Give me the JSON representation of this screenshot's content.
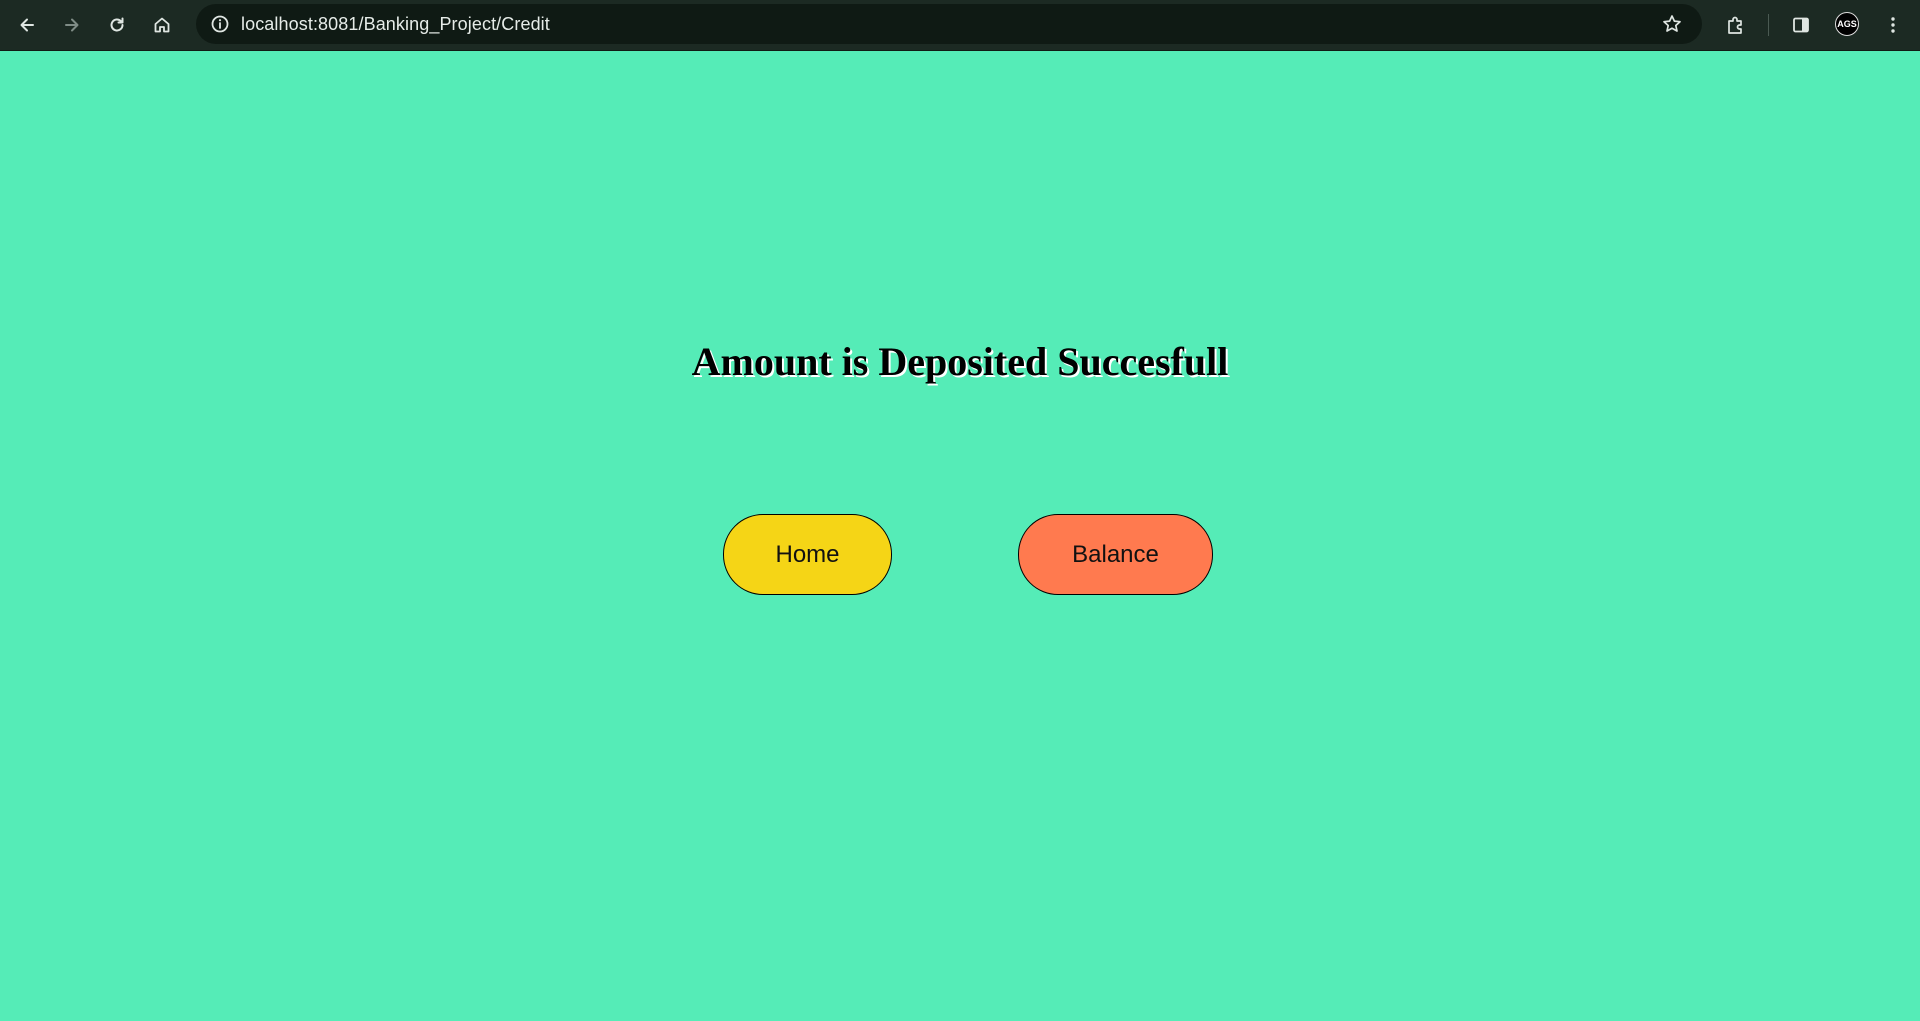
{
  "browser": {
    "url": "localhost:8081/Banking_Project/Credit",
    "profile_initials": "AGS",
    "icons": {
      "back": "back-arrow-icon",
      "forward": "forward-arrow-icon",
      "reload": "reload-icon",
      "home": "home-icon",
      "site_info": "info-icon",
      "bookmark": "star-icon",
      "extensions": "puzzle-icon",
      "side_panel": "side-panel-icon",
      "menu": "kebab-menu-icon"
    }
  },
  "page": {
    "heading": "Amount is Deposited Succesfull",
    "buttons": {
      "home_label": "Home",
      "balance_label": "Balance"
    },
    "colors": {
      "background": "#55ecb7",
      "home_button": "#f5d516",
      "balance_button": "#ff7a4f"
    }
  }
}
